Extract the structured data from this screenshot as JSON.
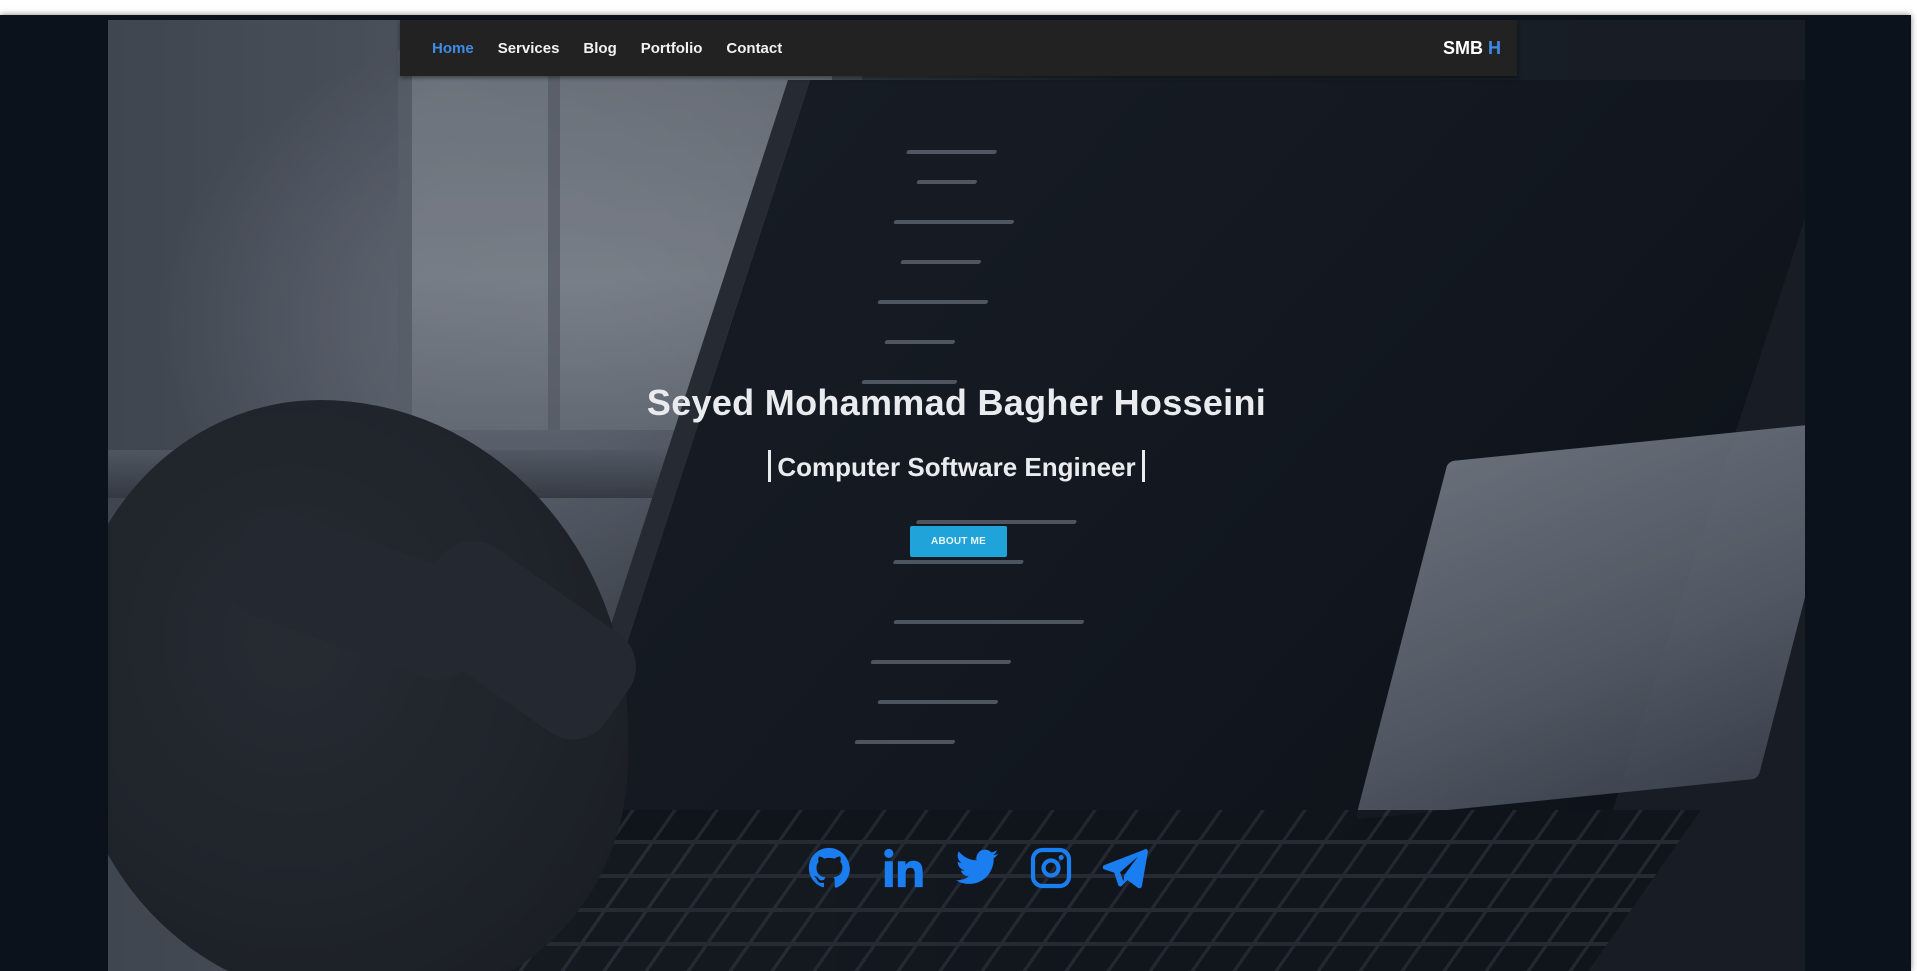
{
  "navbar": {
    "links": [
      {
        "label": "Home",
        "active": true
      },
      {
        "label": "Services",
        "active": false
      },
      {
        "label": "Blog",
        "active": false
      },
      {
        "label": "Portfolio",
        "active": false
      },
      {
        "label": "Contact",
        "active": false
      }
    ],
    "brand": {
      "main": "SMB",
      "accent": "H"
    }
  },
  "hero": {
    "name": "Seyed Mohammad Bagher Hosseini",
    "title": "Computer Software Engineer",
    "button_label": "ABOUT ME"
  },
  "socials": [
    {
      "icon": "github-icon"
    },
    {
      "icon": "linkedin-icon"
    },
    {
      "icon": "twitter-icon"
    },
    {
      "icon": "instagram-icon"
    },
    {
      "icon": "telegram-icon"
    }
  ],
  "colors": {
    "accent": "#3f8be6",
    "navbar_bg": "#222222",
    "button_bg": "#1fa3d8",
    "social_icon": "#1a7ef0"
  }
}
